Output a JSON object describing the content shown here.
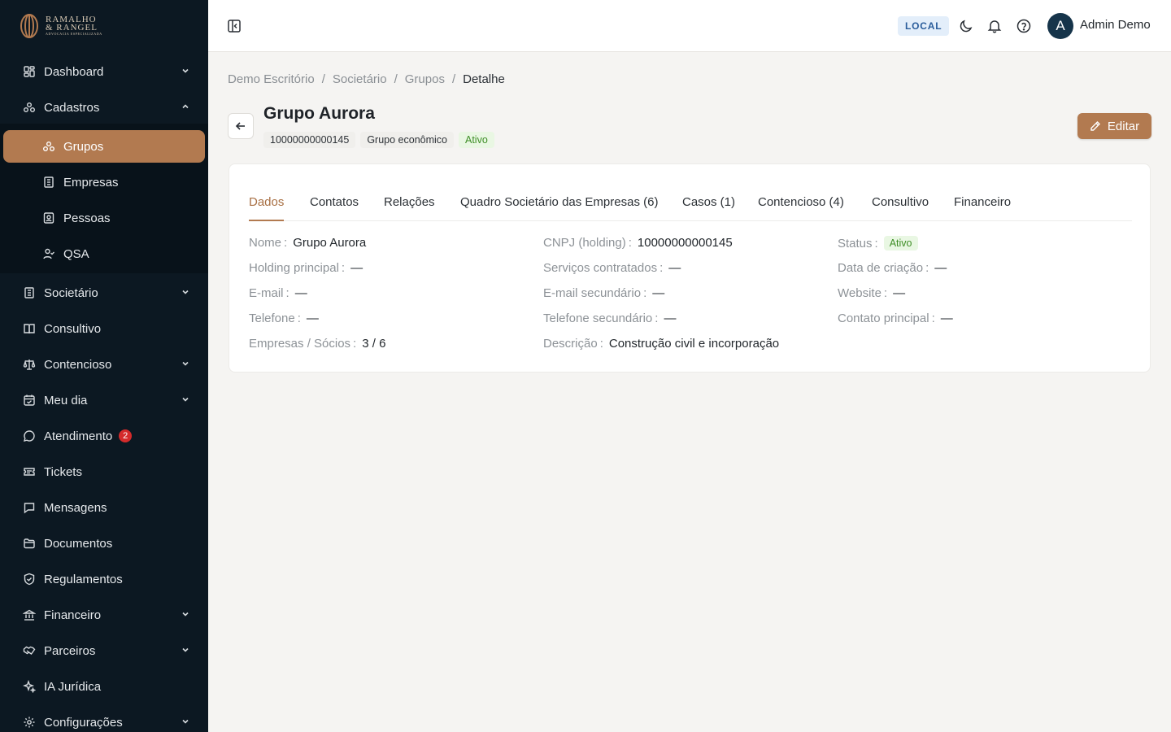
{
  "brand": {
    "name_line1": "RAMALHO",
    "name_line2": "& RANGEL",
    "tagline": "ADVOCACIA ESPECIALIZADA"
  },
  "sidebar": {
    "items": [
      {
        "label": "Dashboard",
        "icon": "dashboard-icon",
        "has_chevron": true,
        "expanded": false
      },
      {
        "label": "Cadastros",
        "icon": "groups-icon",
        "has_chevron": true,
        "expanded": true
      },
      {
        "label": "Societário",
        "icon": "building-icon",
        "has_chevron": true,
        "expanded": false
      },
      {
        "label": "Consultivo",
        "icon": "book-icon",
        "has_chevron": false
      },
      {
        "label": "Contencioso",
        "icon": "scale-icon",
        "has_chevron": true,
        "expanded": false
      },
      {
        "label": "Meu dia",
        "icon": "calendar-icon",
        "has_chevron": true,
        "expanded": false
      },
      {
        "label": "Atendimento",
        "icon": "chat-icon",
        "has_chevron": false,
        "badge": "2"
      },
      {
        "label": "Tickets",
        "icon": "ticket-icon",
        "has_chevron": false
      },
      {
        "label": "Mensagens",
        "icon": "message-icon",
        "has_chevron": false
      },
      {
        "label": "Documentos",
        "icon": "folder-icon",
        "has_chevron": false
      },
      {
        "label": "Regulamentos",
        "icon": "shield-icon",
        "has_chevron": false
      },
      {
        "label": "Financeiro",
        "icon": "bank-icon",
        "has_chevron": true,
        "expanded": false
      },
      {
        "label": "Parceiros",
        "icon": "handshake-icon",
        "has_chevron": true,
        "expanded": false
      },
      {
        "label": "IA Jurídica",
        "icon": "sparkles-icon",
        "has_chevron": false
      },
      {
        "label": "Configurações",
        "icon": "gear-icon",
        "has_chevron": true,
        "expanded": false
      }
    ],
    "sub_items": [
      {
        "label": "Grupos",
        "icon": "groups-icon",
        "active": true
      },
      {
        "label": "Empresas",
        "icon": "building-icon",
        "active": false
      },
      {
        "label": "Pessoas",
        "icon": "id-card-icon",
        "active": false
      },
      {
        "label": "QSA",
        "icon": "user-check-icon",
        "active": false
      }
    ]
  },
  "topbar": {
    "env_badge": "LOCAL",
    "avatar_initial": "A",
    "user_name": "Admin Demo"
  },
  "breadcrumb": [
    "Demo Escritório",
    "Societário",
    "Grupos",
    "Detalhe"
  ],
  "breadcrumb_separator": "/",
  "header": {
    "title": "Grupo Aurora",
    "cnpj": "10000000000145",
    "type": "Grupo econômico",
    "status": "Ativo",
    "edit_label": "Editar"
  },
  "tabs": [
    {
      "label": "Dados",
      "active": true
    },
    {
      "label": "Contatos"
    },
    {
      "label": "Relações"
    },
    {
      "label": "Quadro Societário das Empresas (6)"
    },
    {
      "label": "Casos (1)"
    },
    {
      "label": "Contencioso (4)"
    },
    {
      "label": "Consultivo"
    },
    {
      "label": "Financeiro"
    }
  ],
  "fields": [
    {
      "label": "Nome",
      "value": "Grupo Aurora"
    },
    {
      "label": "Holding principal",
      "value": "—"
    },
    {
      "label": "E-mail",
      "value": "—"
    },
    {
      "label": "Telefone",
      "value": "—"
    },
    {
      "label": "Empresas / Sócios",
      "value": "3 / 6"
    },
    {
      "label": "CNPJ (holding)",
      "value": "10000000000145"
    },
    {
      "label": "Serviços contratados",
      "value": "—"
    },
    {
      "label": "E-mail secundário",
      "value": "—"
    },
    {
      "label": "Telefone secundário",
      "value": "—"
    },
    {
      "label": "Descrição",
      "value": "Construção civil e incorporação"
    },
    {
      "label": "Status",
      "value": "Ativo"
    },
    {
      "label": "Data de criação",
      "value": "—"
    },
    {
      "label": "Website",
      "value": "—"
    },
    {
      "label": "Contato principal",
      "value": "—"
    }
  ],
  "colors": {
    "accent": "#b27a50",
    "sidebar_bg": "#0c1822",
    "status_green": "#3e8e26",
    "env_badge_bg": "#e3eefa"
  }
}
